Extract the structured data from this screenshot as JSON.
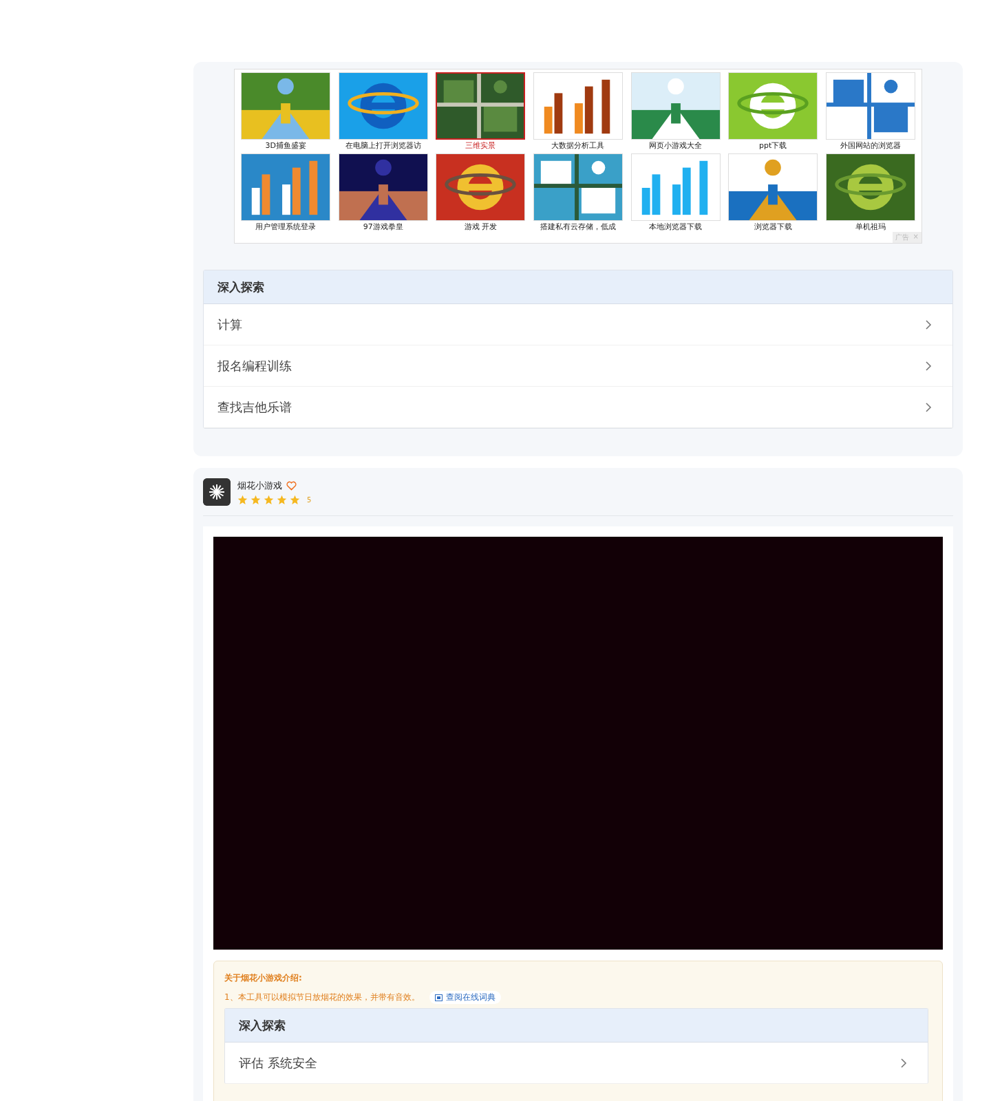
{
  "ad_grid": {
    "items": [
      {
        "caption": "3D捕鱼盛宴",
        "selected": false
      },
      {
        "caption": "在电脑上打开浏览器访",
        "selected": false
      },
      {
        "caption": "三维实景",
        "selected": true
      },
      {
        "caption": "大数据分析工具",
        "selected": false
      },
      {
        "caption": "网页小游戏大全",
        "selected": false
      },
      {
        "caption": "ppt下载",
        "selected": false
      },
      {
        "caption": "外国网站的浏览器",
        "selected": false
      },
      {
        "caption": "用户管理系统登录",
        "selected": false
      },
      {
        "caption": "97游戏拳皇",
        "selected": false
      },
      {
        "caption": "游戏 开发",
        "selected": false
      },
      {
        "caption": "搭建私有云存储，低成",
        "selected": false
      },
      {
        "caption": "本地浏览器下载",
        "selected": false
      },
      {
        "caption": "浏览器下载",
        "selected": false
      },
      {
        "caption": "单机祖玛",
        "selected": false
      }
    ],
    "ad_label": "广告",
    "close": "×"
  },
  "explore": {
    "title": "深入探索",
    "items": [
      "计算",
      "报名编程训练",
      "查找吉他乐谱"
    ]
  },
  "app": {
    "name": "烟花小游戏",
    "stars": 5,
    "rating": "5"
  },
  "intro": {
    "title": "关于烟花小游戏介绍:",
    "line": "1、本工具可以模拟节日放烟花的效果，并带有音效。",
    "dict_link": "查阅在线词典"
  },
  "intro_explore": {
    "title": "深入探索",
    "items": [
      "评估 系统安全"
    ]
  }
}
